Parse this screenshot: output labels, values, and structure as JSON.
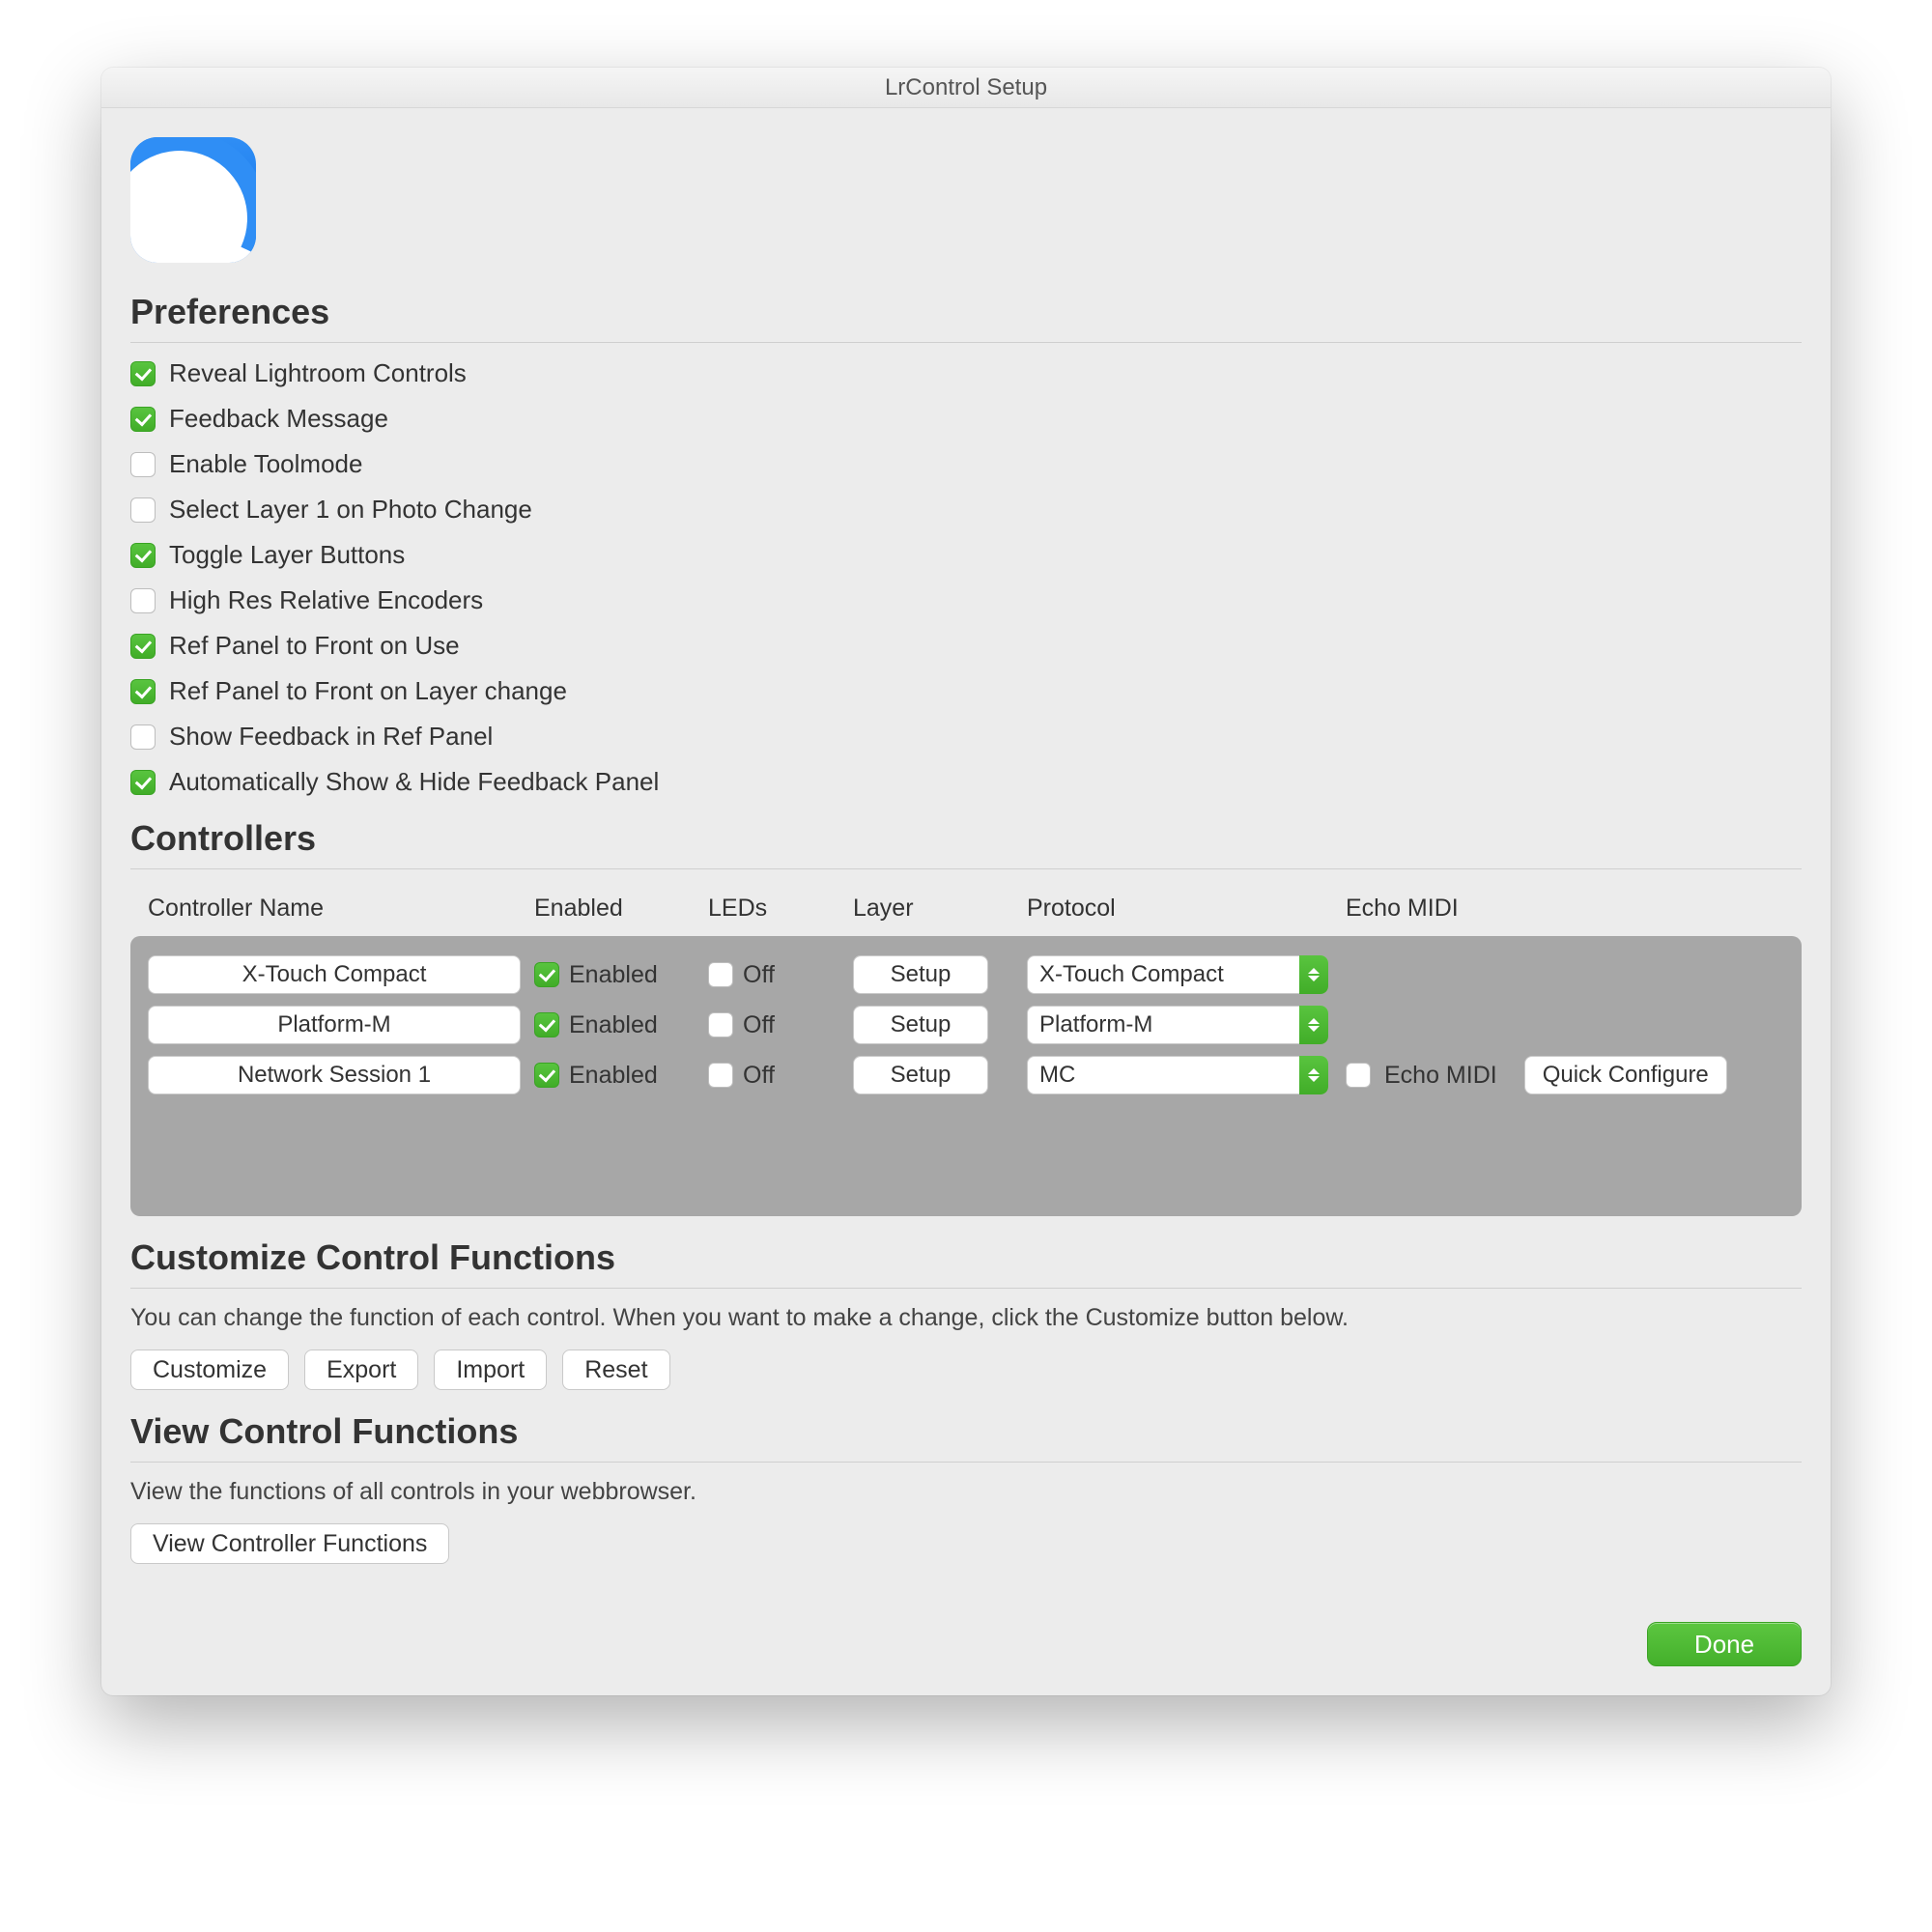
{
  "window": {
    "title": "LrControl Setup"
  },
  "sections": {
    "preferences_title": "Preferences",
    "controllers_title": "Controllers",
    "customize_title": "Customize Control Functions",
    "view_title": "View Control Functions"
  },
  "preferences": [
    {
      "label": "Reveal Lightroom Controls",
      "checked": true
    },
    {
      "label": "Feedback Message",
      "checked": true
    },
    {
      "label": "Enable Toolmode",
      "checked": false
    },
    {
      "label": "Select Layer 1 on Photo Change",
      "checked": false
    },
    {
      "label": "Toggle Layer Buttons",
      "checked": true
    },
    {
      "label": "High Res Relative Encoders",
      "checked": false
    },
    {
      "label": "Ref Panel to Front on Use",
      "checked": true
    },
    {
      "label": "Ref Panel to Front on Layer change",
      "checked": true
    },
    {
      "label": "Show Feedback in Ref Panel",
      "checked": false
    },
    {
      "label": "Automatically Show & Hide Feedback Panel",
      "checked": true
    }
  ],
  "controllers": {
    "headers": {
      "name": "Controller Name",
      "enabled": "Enabled",
      "leds": "LEDs",
      "layer": "Layer",
      "protocol": "Protocol",
      "echo": "Echo MIDI"
    },
    "enabled_label": "Enabled",
    "off_label": "Off",
    "setup_label": "Setup",
    "echo_label": "Echo MIDI",
    "quick_configure_label": "Quick Configure",
    "rows": [
      {
        "name": "X-Touch Compact",
        "enabled": true,
        "leds_off": false,
        "protocol": "X-Touch Compact",
        "show_echo": false
      },
      {
        "name": "Platform-M",
        "enabled": true,
        "leds_off": false,
        "protocol": "Platform-M",
        "show_echo": false
      },
      {
        "name": "Network Session 1",
        "enabled": true,
        "leds_off": false,
        "protocol": "MC",
        "show_echo": true,
        "echo_checked": false
      }
    ]
  },
  "customize": {
    "desc": "You can change the function of each control. When you want to make a change, click the Customize button below.",
    "buttons": {
      "customize": "Customize",
      "export": "Export",
      "import": "Import",
      "reset": "Reset"
    }
  },
  "view": {
    "desc": "View the functions of all controls in your webbrowser.",
    "button": "View Controller Functions"
  },
  "footer": {
    "done": "Done"
  }
}
